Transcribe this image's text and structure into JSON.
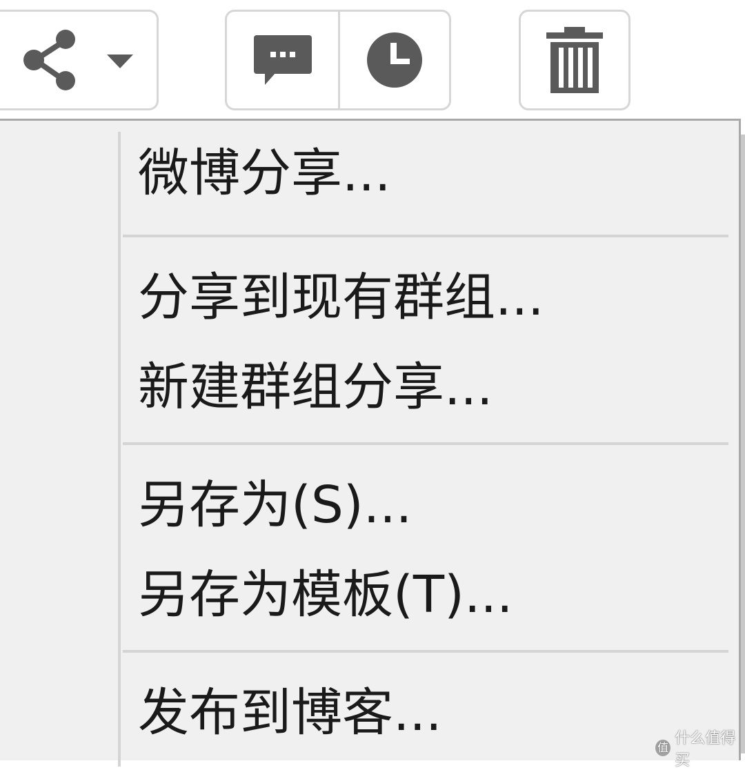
{
  "toolbar": {
    "share_icon": "share-icon",
    "dropdown_icon": "caret-down-icon",
    "comment_icon": "comment-icon",
    "clock_icon": "clock-icon",
    "trash_icon": "trash-icon",
    "icon_color": "#5a5a5a"
  },
  "menu": {
    "groups": [
      {
        "items": [
          {
            "label": "微博分享..."
          }
        ]
      },
      {
        "items": [
          {
            "label": "分享到现有群组..."
          },
          {
            "label": "新建群组分享..."
          }
        ]
      },
      {
        "items": [
          {
            "label": "另存为(S)..."
          },
          {
            "label": "另存为模板(T)..."
          }
        ]
      },
      {
        "items": [
          {
            "label": "发布到博客..."
          }
        ]
      }
    ]
  },
  "watermark": {
    "badge": "值",
    "text": "什么值得买"
  }
}
